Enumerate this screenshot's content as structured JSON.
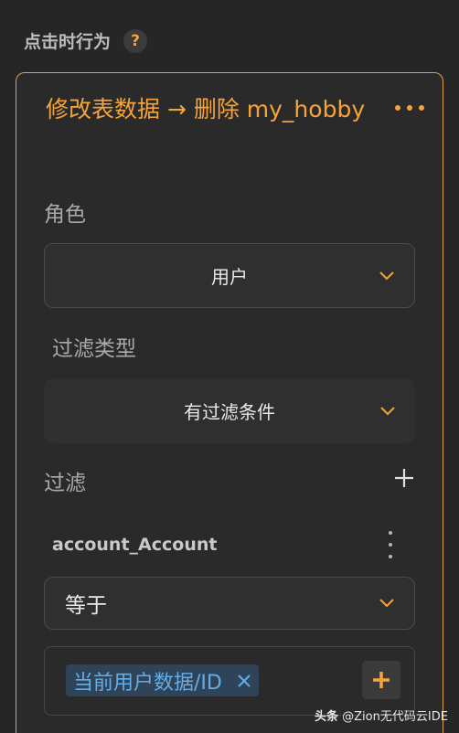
{
  "section": {
    "title": "点击时行为",
    "help": "?"
  },
  "card": {
    "header": "修改表数据 → 删除 my_hobby",
    "role": {
      "label": "角色",
      "value": "用户"
    },
    "filter_type": {
      "label": "过滤类型",
      "value": "有过滤条件"
    },
    "filter": {
      "label": "过滤",
      "field": "account_Account",
      "operator": "等于",
      "value_tag": "当前用户数据/ID"
    }
  },
  "watermark": {
    "brand": "头条",
    "handle": "@Zion无代码云IDE"
  },
  "colors": {
    "accent": "#f5a43a",
    "tag_text": "#63aee8",
    "background": "#262626"
  }
}
